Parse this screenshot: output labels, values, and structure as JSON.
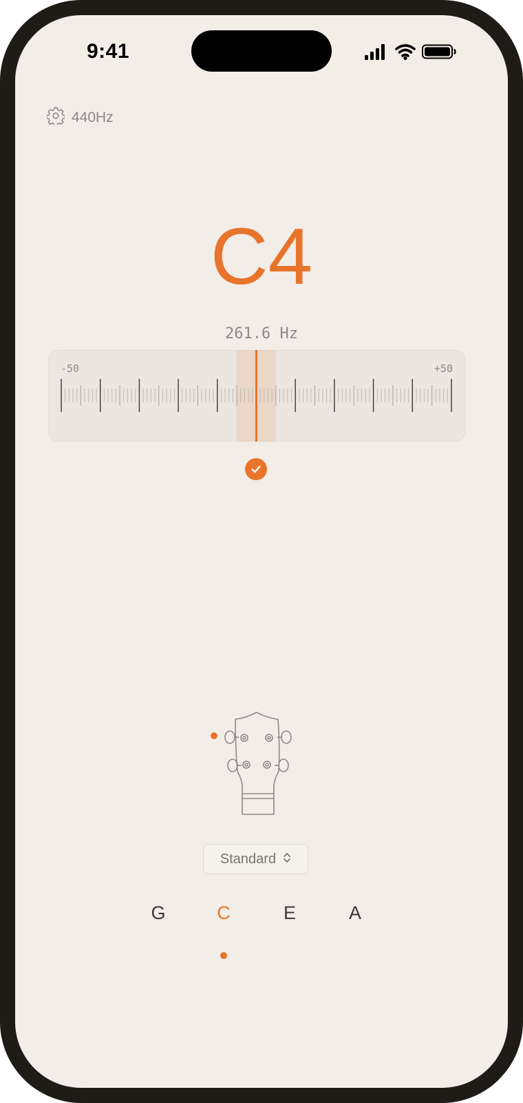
{
  "status_bar": {
    "time": "9:41",
    "icons": [
      "cellular-signal-icon",
      "wifi-icon",
      "battery-icon"
    ]
  },
  "settings": {
    "icon": "gear-icon",
    "reference_pitch": "440Hz"
  },
  "reading": {
    "note": "C4",
    "frequency": "261.6 Hz",
    "cents_offset": 0,
    "in_tune": true
  },
  "meter": {
    "min_label": "-50",
    "max_label": "+50",
    "range": [
      -50,
      50
    ]
  },
  "instrument": {
    "type": "ukulele-headstock",
    "active_peg_indicator": "orange-dot"
  },
  "tuning": {
    "selected": "Standard",
    "icon": "chevron-up-down-icon"
  },
  "strings": [
    {
      "label": "G",
      "active": false
    },
    {
      "label": "C",
      "active": true
    },
    {
      "label": "E",
      "active": false
    },
    {
      "label": "A",
      "active": false
    }
  ],
  "colors": {
    "accent": "#e8742b",
    "background": "#f2ede7",
    "muted_text": "#8d8983"
  }
}
